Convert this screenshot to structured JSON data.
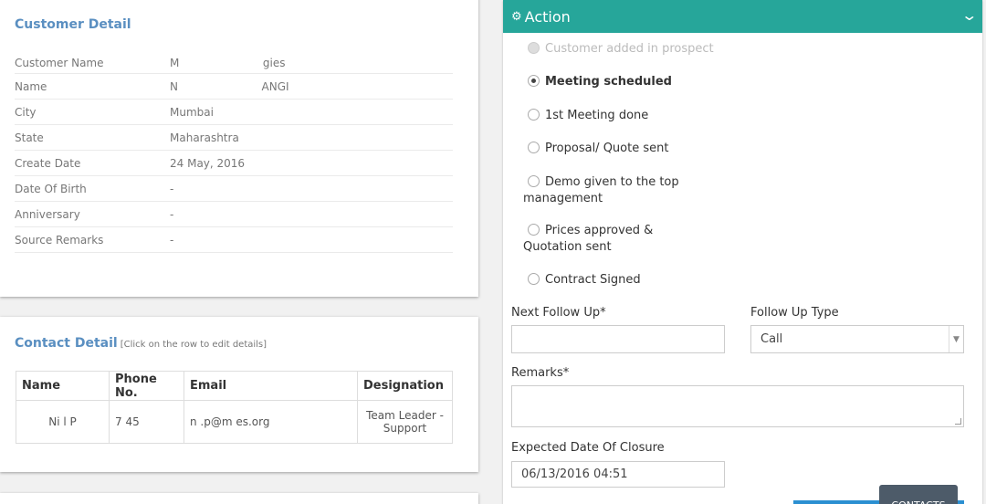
{
  "customer_detail": {
    "title": "Customer Detail",
    "rows": [
      {
        "label": "Customer Name",
        "value": "M                        gies"
      },
      {
        "label": "Name",
        "value": "N                        ANGI"
      },
      {
        "label": "City",
        "value": "Mumbai"
      },
      {
        "label": "State",
        "value": "Maharashtra"
      },
      {
        "label": "Create Date",
        "value": "24 May, 2016"
      },
      {
        "label": "Date Of Birth",
        "value": "-"
      },
      {
        "label": "Anniversary",
        "value": "-"
      },
      {
        "label": "Source Remarks",
        "value": "-"
      }
    ]
  },
  "contact_detail": {
    "title": "Contact Detail",
    "hint": "[Click on the row to edit details]",
    "columns": [
      "Name",
      "Phone No.",
      "Email",
      "Designation"
    ],
    "rows": [
      {
        "name": "Ni  l  P",
        "phone": "7          45",
        "email": "n      .p@m                          es.org",
        "designation": "Team Leader - Support"
      }
    ]
  },
  "action": {
    "title": "Action",
    "stages": [
      {
        "label": "Customer added in prospect",
        "state": "disabled"
      },
      {
        "label": "Meeting scheduled",
        "state": "checked"
      },
      {
        "label": "1st Meeting done",
        "state": "unchecked"
      },
      {
        "label": "Proposal/ Quote sent",
        "state": "unchecked"
      },
      {
        "label": "Demo given to the top management",
        "state": "unchecked"
      },
      {
        "label": "Prices approved & Quotation sent",
        "state": "unchecked"
      },
      {
        "label": "Contract Signed",
        "state": "unchecked"
      }
    ],
    "next_follow_up_label": "Next Follow Up*",
    "next_follow_up_value": "",
    "follow_up_type_label": "Follow Up Type",
    "follow_up_type_value": "Call",
    "remarks_label": "Remarks*",
    "remarks_value": "",
    "expected_closure_label": "Expected Date Of Closure",
    "expected_closure_value": "06/13/2016 04:51"
  },
  "contacts_tab_label": "CONTACTS",
  "colors": {
    "accent": "#26a69a",
    "section_title": "#5a8fc1",
    "tab": "#4d5b69",
    "blue": "#2b8fd1"
  },
  "icons": {
    "action": "cogs-icon",
    "collapse": "chevron-down-icon"
  }
}
